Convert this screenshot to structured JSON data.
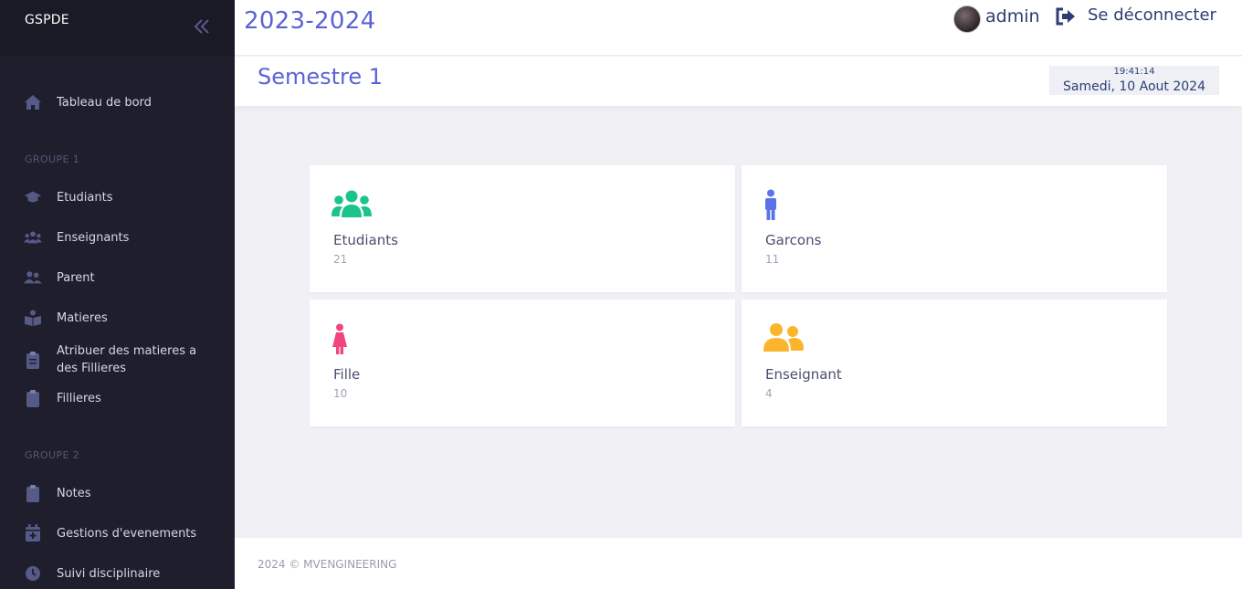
{
  "sidebar": {
    "brand": "GSPDE",
    "items": {
      "dashboard": "Tableau de bord",
      "students": "Etudiants",
      "teachers": "Enseignants",
      "parent": "Parent",
      "subjects": "Matieres",
      "assign": "Atribuer des matieres a des Fillieres",
      "branches": "Fillieres",
      "notes": "Notes",
      "events": "Gestions d'evenements",
      "discipline": "Suivi disciplinaire"
    },
    "groups": {
      "g1": "GROUPE 1",
      "g2": "GROUPE 2"
    }
  },
  "header": {
    "year": "2023-2024",
    "username": "admin",
    "logout_label": "Se déconnecter"
  },
  "subheader": {
    "semester": "Semestre 1",
    "time": "19:41:14",
    "date": "Samedi, 10 Aout 2024"
  },
  "stats": {
    "students": {
      "label": "Etudiants",
      "value": "21",
      "color": "#1bc48a"
    },
    "boys": {
      "label": "Garcons",
      "value": "11",
      "color": "#5b73e8"
    },
    "girls": {
      "label": "Fille",
      "value": "10",
      "color": "#f2457d"
    },
    "teachers": {
      "label": "Enseignant",
      "value": "4",
      "color": "#fbb52c"
    }
  },
  "footer": {
    "text": "2024 © MVENGINEERING"
  },
  "colors": {
    "accent": "#5a63d6",
    "sidebar_bg": "#1e1e2d",
    "sidebar_icon": "#565a86"
  }
}
